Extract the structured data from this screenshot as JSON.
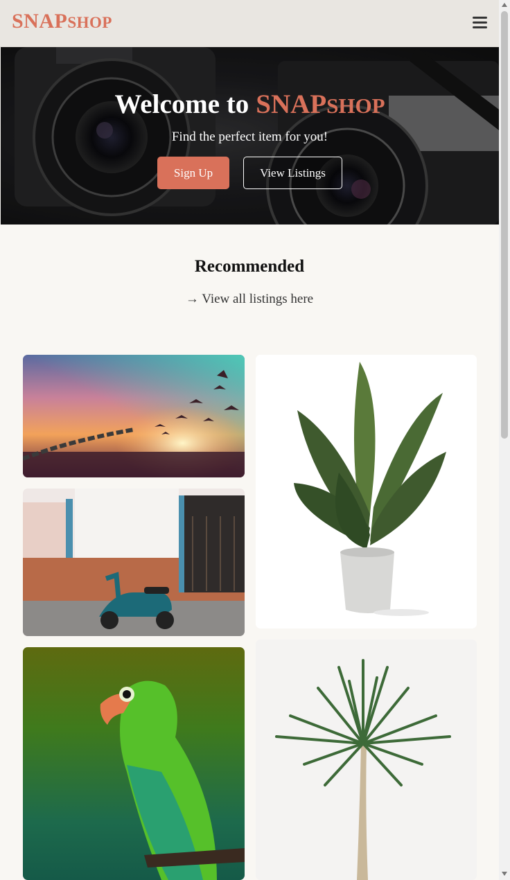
{
  "brand": {
    "main": "SNAP",
    "small": "SHOP"
  },
  "nav": {
    "menu_icon": "hamburger-menu-icon"
  },
  "hero": {
    "title_prefix": "Welcome to",
    "brand_main": "SNAP",
    "brand_small": "SHOP",
    "subtitle": "Find the perfect item for you!",
    "signup_label": "Sign Up",
    "view_listings_label": "View Listings"
  },
  "recommended": {
    "title": "Recommended",
    "view_all": "→ View all listings here"
  },
  "colors": {
    "accent": "#d9715a",
    "navbar": "#e9e6e1",
    "page_bg": "#f9f7f3"
  },
  "listings": [
    {
      "image": "birds-and-chain-sunset"
    },
    {
      "image": "teal-scooter-by-wall"
    },
    {
      "image": "green-parakeet"
    },
    {
      "image": "potted-plant"
    },
    {
      "image": "dracaena-tree"
    }
  ]
}
